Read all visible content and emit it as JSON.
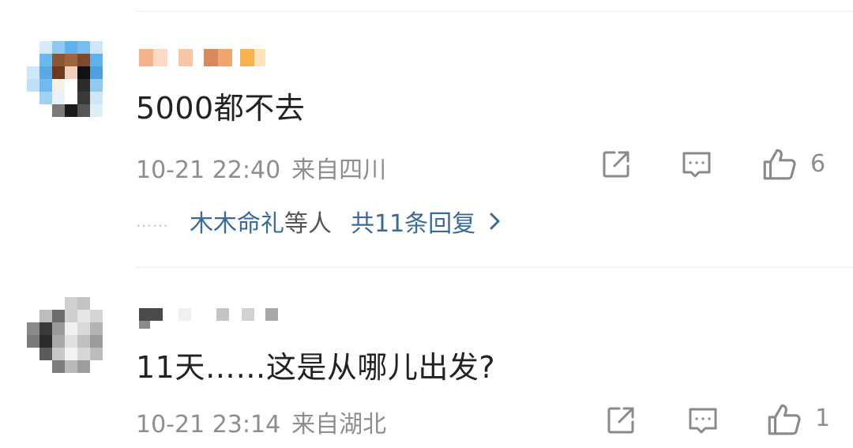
{
  "comments": [
    {
      "text": "5000都不去",
      "time": "10-21 22:40",
      "location": "来自四川",
      "likes": "6",
      "replies": {
        "dots": "……",
        "names": "木木命礼",
        "others": "等人",
        "count": "共11条回复"
      }
    },
    {
      "text": "11天……这是从哪儿出发?",
      "time": "10-21 23:14",
      "location": "来自湖北",
      "likes": "1"
    }
  ],
  "icons": {
    "share": "share-icon",
    "comment": "comment-icon",
    "like": "thumbs-up-icon",
    "chevron": "chevron-right-icon"
  },
  "colors": {
    "text": "#222222",
    "meta": "#8e8e8e",
    "link": "#3a6a95",
    "divider": "#ececec"
  }
}
